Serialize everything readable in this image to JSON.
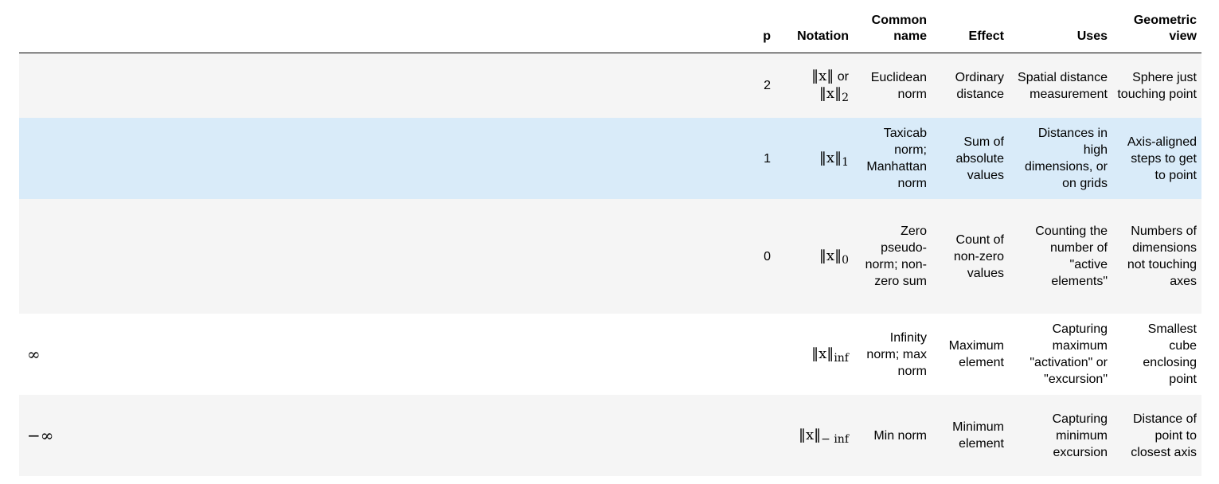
{
  "headers": {
    "p": "p",
    "notation": "Notation",
    "common_name": "Common name",
    "effect": "Effect",
    "uses": "Uses",
    "geometric_view": "Geometric view"
  },
  "rows": [
    {
      "p": "2",
      "notation_base": "‖x‖",
      "notation_extra": "or",
      "notation_line2_base": "‖x‖",
      "notation_line2_sub": "2",
      "common_name": "Euclidean norm",
      "effect": "Ordinary distance",
      "uses": "Spatial distance measurement",
      "geometric_view": "Sphere just touching point"
    },
    {
      "p": "1",
      "notation_base": "‖x‖",
      "notation_sub": "1",
      "common_name": "Taxicab norm; Manhattan norm",
      "effect": "Sum of absolute values",
      "uses": "Distances in high dimensions, or on grids",
      "geometric_view": "Axis-aligned steps to get to point"
    },
    {
      "p": "0",
      "notation_base": "‖x‖",
      "notation_sub": "0",
      "common_name": "Zero pseudo-norm; non-zero sum",
      "effect": "Count of non-zero values",
      "uses": "Counting the number of \"active elements\"",
      "geometric_view": "Numbers of dimensions not touching axes"
    },
    {
      "p": "∞",
      "notation_base": "‖x‖",
      "notation_sub": "inf",
      "common_name": "Infinity norm; max norm",
      "effect": "Maximum element",
      "uses": "Capturing maximum \"activation\" or \"excursion\"",
      "geometric_view": "Smallest cube enclosing point"
    },
    {
      "p": "−∞",
      "notation_base": "‖x‖",
      "notation_sub": "− inf",
      "common_name": "Min norm",
      "effect": "Minimum element",
      "uses": "Capturing minimum excursion",
      "geometric_view": "Distance of point to closest axis"
    }
  ]
}
